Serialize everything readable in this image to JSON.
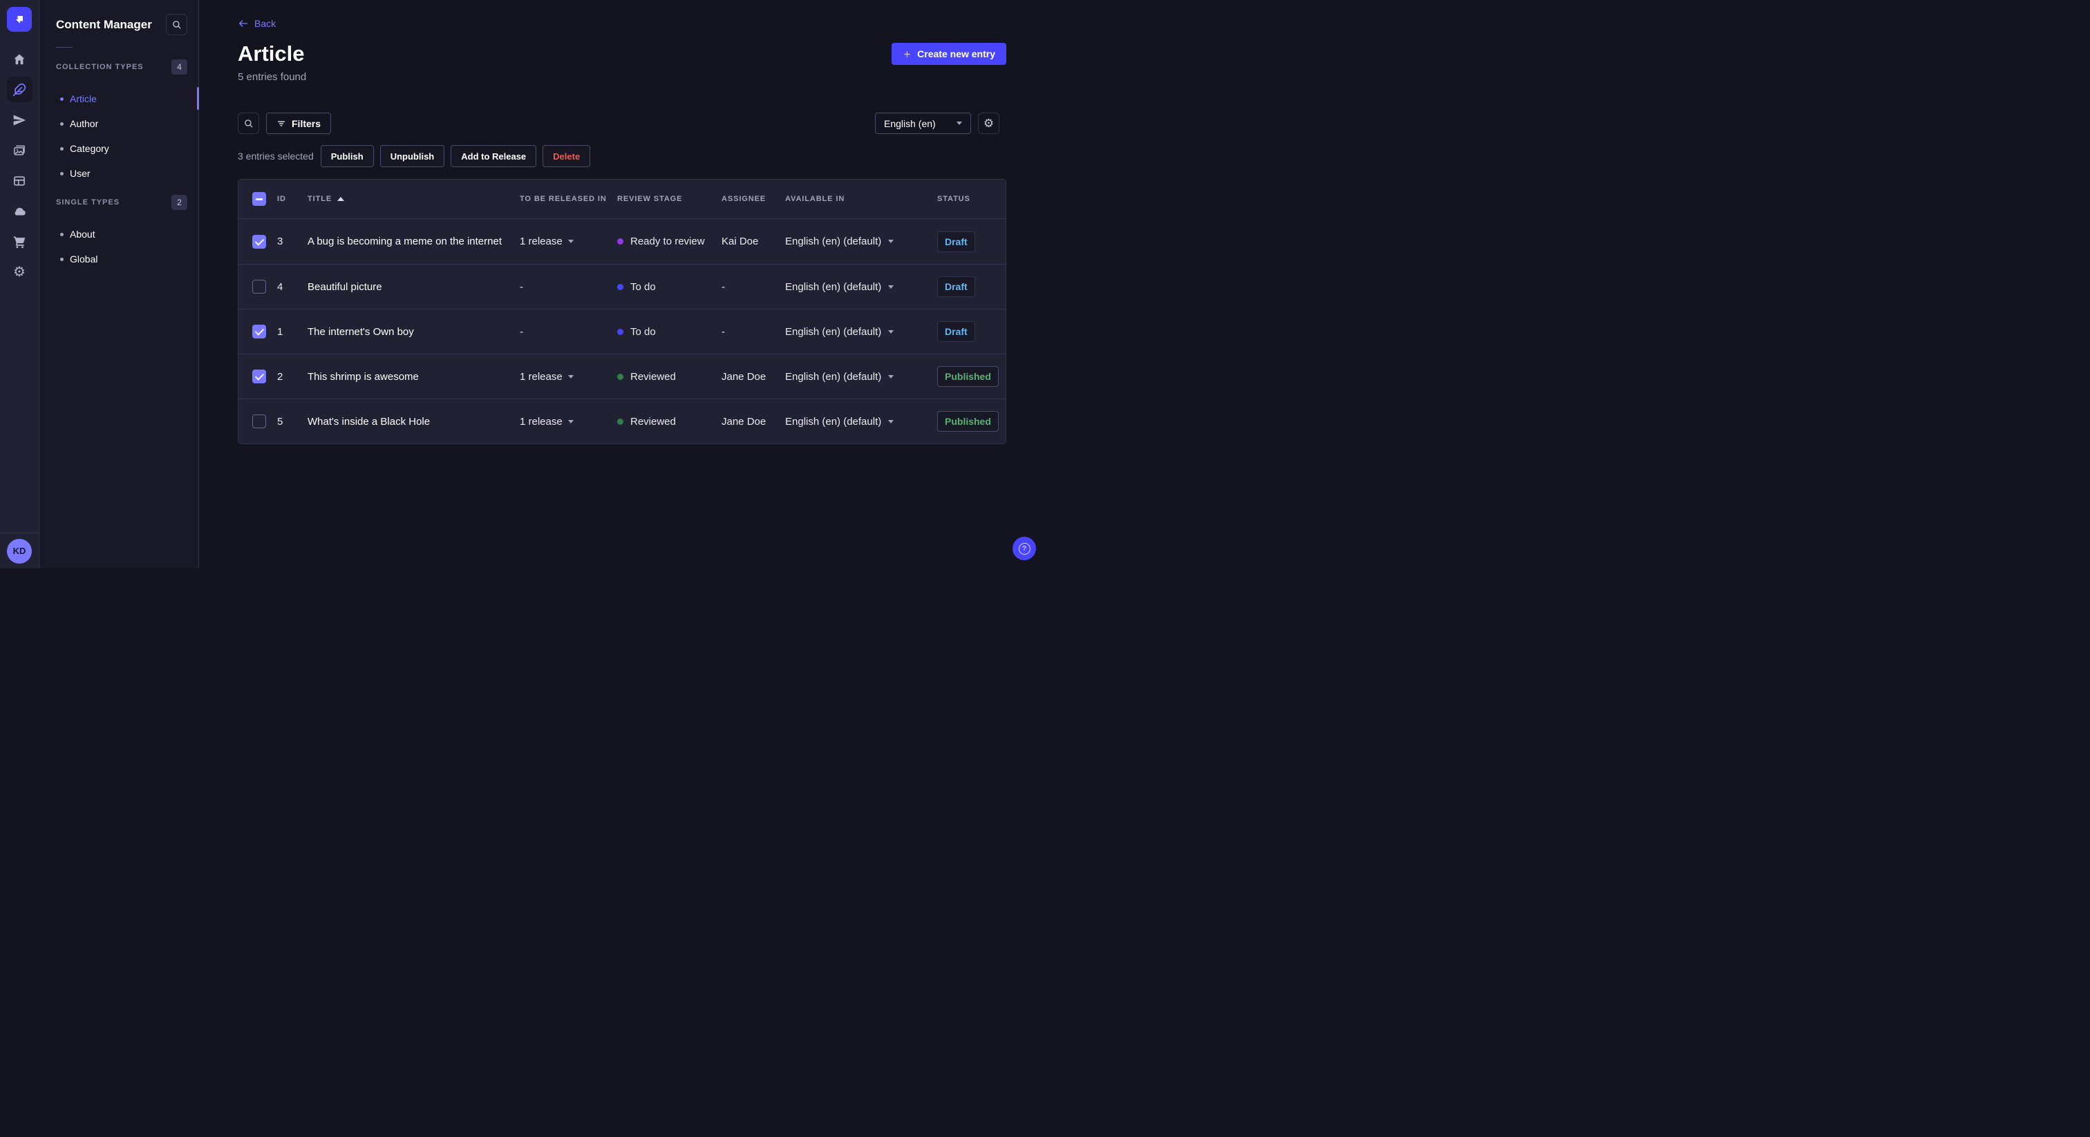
{
  "colors": {
    "primary": "#4945ff",
    "primary_light": "#7b79ff",
    "surface": "#212134",
    "background": "#141420",
    "draft_blue": "#66b7f1",
    "published_green": "#5cb176",
    "danger_red": "#ee5e52"
  },
  "rail": {
    "icons": [
      "strapi-logo",
      "home",
      "content-manager-feather",
      "releases-paper-plane",
      "media-library-images",
      "content-type-builder-layout",
      "cloud",
      "marketplace-cart",
      "settings-gear"
    ],
    "active_icon": "content-manager-feather"
  },
  "user": {
    "initials": "KD"
  },
  "subnav": {
    "title": "Content Manager",
    "search_icon": "search-icon",
    "sections": [
      {
        "label": "COLLECTION TYPES",
        "count": "4",
        "items": [
          {
            "label": "Article",
            "active": true
          },
          {
            "label": "Author",
            "active": false
          },
          {
            "label": "Category",
            "active": false
          },
          {
            "label": "User",
            "active": false
          }
        ]
      },
      {
        "label": "SINGLE TYPES",
        "count": "2",
        "items": [
          {
            "label": "About",
            "active": false
          },
          {
            "label": "Global",
            "active": false
          }
        ]
      }
    ]
  },
  "header": {
    "back_label": "Back",
    "title": "Article",
    "subtitle": "5 entries found",
    "create_button": "Create new entry"
  },
  "toolbar": {
    "filters_label": "Filters",
    "locale_value": "English (en)",
    "selected_text": "3 entries selected",
    "actions": [
      "Publish",
      "Unpublish",
      "Add to Release",
      "Delete"
    ]
  },
  "table": {
    "columns": [
      "ID",
      "TITLE",
      "TO BE RELEASED IN",
      "REVIEW STAGE",
      "ASSIGNEE",
      "AVAILABLE IN",
      "STATUS"
    ],
    "sorted_column": "TITLE",
    "sort_direction": "asc",
    "header_checkbox_state": "indeterminate",
    "rows": [
      {
        "checked": true,
        "id": "3",
        "title": "A bug is becoming a meme on the internet",
        "release": "1 release",
        "stage": "Ready to review",
        "stage_color": "#9736e8",
        "assignee": "Kai Doe",
        "locale": "English (en) (default)",
        "status": "Draft"
      },
      {
        "checked": false,
        "id": "4",
        "title": "Beautiful picture",
        "release": "-",
        "stage": "To do",
        "stage_color": "#4945ff",
        "assignee": "-",
        "locale": "English (en) (default)",
        "status": "Draft"
      },
      {
        "checked": true,
        "id": "1",
        "title": "The internet's Own boy",
        "release": "-",
        "stage": "To do",
        "stage_color": "#4945ff",
        "assignee": "-",
        "locale": "English (en) (default)",
        "status": "Draft"
      },
      {
        "checked": true,
        "id": "2",
        "title": "This shrimp is awesome",
        "release": "1 release",
        "stage": "Reviewed",
        "stage_color": "#328048",
        "assignee": "Jane Doe",
        "locale": "English (en) (default)",
        "status": "Published"
      },
      {
        "checked": false,
        "id": "5",
        "title": "What's inside a Black Hole",
        "release": "1 release",
        "stage": "Reviewed",
        "stage_color": "#328048",
        "assignee": "Jane Doe",
        "locale": "English (en) (default)",
        "status": "Published"
      }
    ]
  },
  "help": {
    "icon": "question-mark-icon"
  }
}
